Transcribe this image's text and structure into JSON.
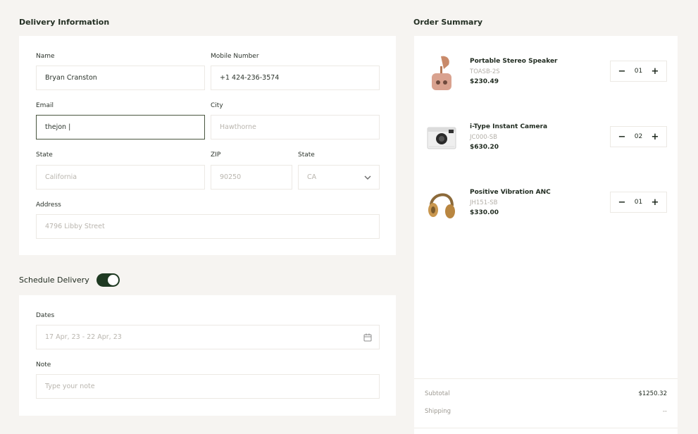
{
  "delivery": {
    "title": "Delivery Information",
    "name": {
      "label": "Name",
      "value": "Bryan Cranston"
    },
    "mobile": {
      "label": "Mobile Number",
      "value": "+1 424-236-3574"
    },
    "email": {
      "label": "Email",
      "value": "thejon |"
    },
    "city": {
      "label": "City",
      "placeholder": "Hawthorne"
    },
    "state_text": {
      "label": "State",
      "placeholder": "California"
    },
    "zip": {
      "label": "ZIP",
      "placeholder": "90250"
    },
    "state_select": {
      "label": "State",
      "placeholder": "CA"
    },
    "address": {
      "label": "Address",
      "placeholder": "4796 Libby Street"
    }
  },
  "schedule": {
    "title": "Schedule Delivery",
    "enabled": true,
    "dates": {
      "label": "Dates",
      "placeholder": "17 Apr, 23 - 22 Apr, 23"
    },
    "note": {
      "label": "Note",
      "placeholder": "Type your note"
    }
  },
  "order": {
    "title": "Order Summary",
    "items": [
      {
        "name": "Portable Stereo Speaker",
        "sku": "TOASB-2S",
        "price": "$230.49",
        "qty": "01",
        "icon": "speaker-icon"
      },
      {
        "name": "i-Type Instant Camera",
        "sku": "JC000-SB",
        "price": "$630.20",
        "qty": "02",
        "icon": "camera-icon"
      },
      {
        "name": "Positive Vibration ANC",
        "sku": "JH151-SB",
        "price": "$330.00",
        "qty": "01",
        "icon": "headphones-icon"
      }
    ],
    "subtotal": {
      "label": "Subtotal",
      "value": "$1250.32"
    },
    "shipping": {
      "label": "Shipping",
      "value": "--"
    }
  },
  "colors": {
    "accent": "#1f3a22",
    "background": "#f6f4f1",
    "card": "#ffffff",
    "placeholder": "#b9b5ae"
  }
}
